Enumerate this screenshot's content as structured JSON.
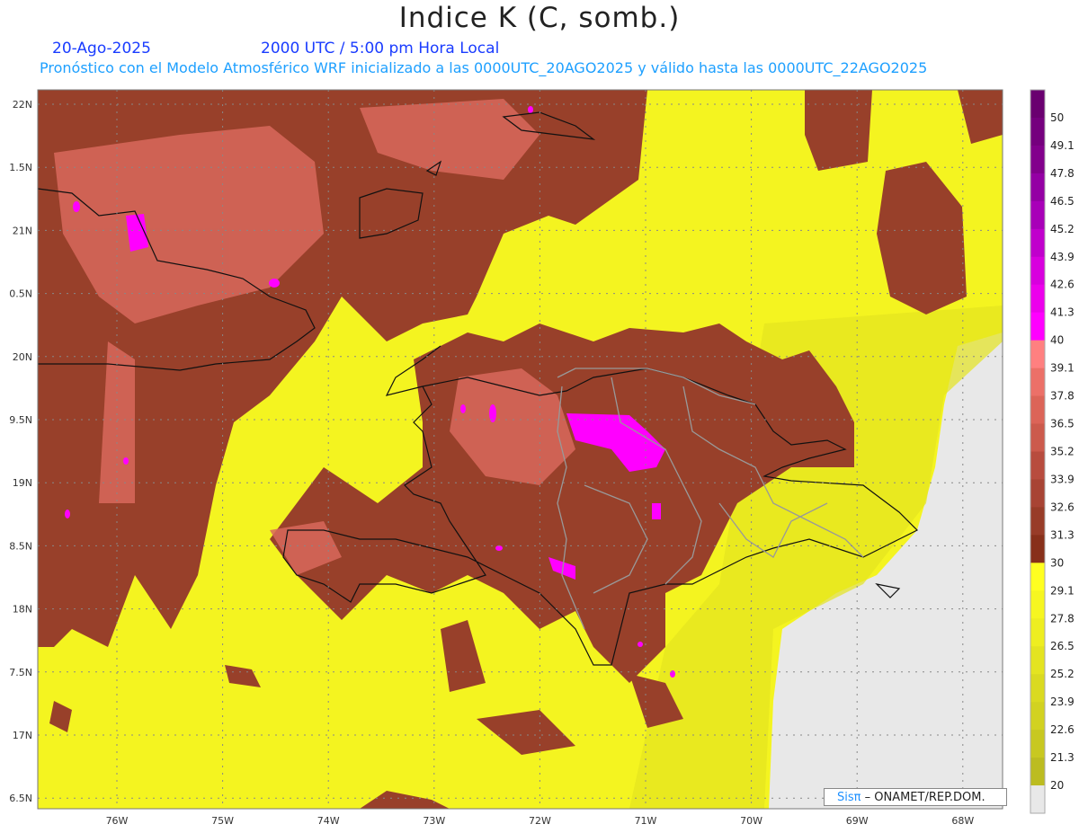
{
  "title": "Indice K (C, somb.)",
  "date": "20-Ago-2025",
  "time": "2000 UTC / 5:00 pm Hora Local",
  "subtitle": "Pronóstico con el Modelo Atmosférico WRF inicializado a las 0000UTC_20AGO2025 y válido hasta las  0000UTC_22AGO2025",
  "lon_labels": [
    "76W",
    "75W",
    "74W",
    "73W",
    "72W",
    "71W",
    "70W",
    "69W",
    "68W"
  ],
  "lat_labels": [
    "22N",
    "1.5N",
    "21N",
    "0.5N",
    "20N",
    "9.5N",
    "19N",
    "8.5N",
    "18N",
    "7.5N",
    "17N",
    "6.5N"
  ],
  "colorbar": {
    "labels": [
      "50",
      "49.1",
      "47.8",
      "46.5",
      "45.2",
      "43.9",
      "42.6",
      "41.3",
      "40",
      "39.1",
      "37.8",
      "36.5",
      "35.2",
      "33.9",
      "32.6",
      "31.3",
      "30",
      "29.1",
      "27.8",
      "26.5",
      "25.2",
      "23.9",
      "22.6",
      "21.3",
      "20"
    ],
    "colors": [
      "#6a0070",
      "#75007e",
      "#82008c",
      "#9400a4",
      "#a800b8",
      "#c000cc",
      "#d800de",
      "#ec00ec",
      "#ff00ff",
      "#ff8080",
      "#ec7068",
      "#dc6458",
      "#cc5a4c",
      "#b84c3e",
      "#a84434",
      "#983c28",
      "#88301a",
      "#ffff20",
      "#f6f620",
      "#eeee20",
      "#e4e420",
      "#dada20",
      "#d2d220",
      "#c8c820",
      "#bcbc20",
      "#e8e8e8"
    ]
  },
  "credit": {
    "logo": "Sisπ",
    "text": " –  ONAMET/REP.DOM."
  }
}
